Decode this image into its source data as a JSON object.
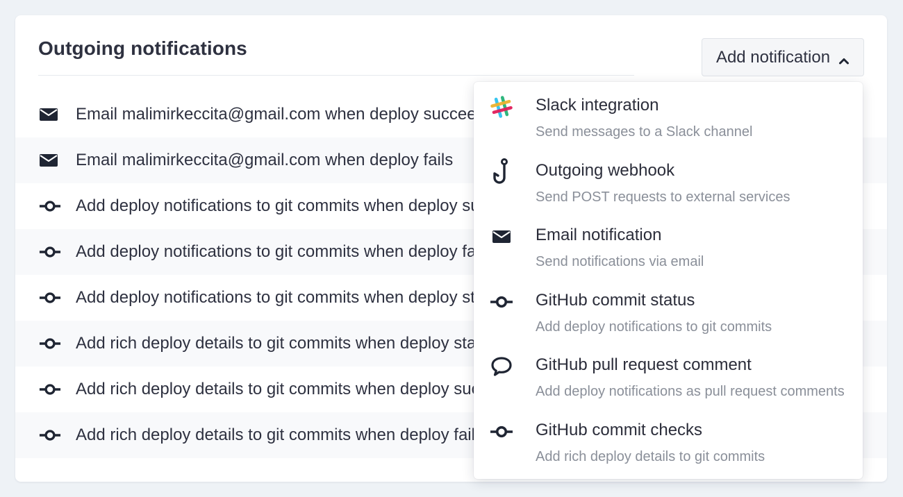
{
  "header": {
    "title": "Outgoing notifications",
    "add_button_label": "Add notification"
  },
  "notifications": [
    {
      "icon": "mail-icon",
      "text": "Email malimirkeccita@gmail.com when deploy succeeds"
    },
    {
      "icon": "mail-icon",
      "text": "Email malimirkeccita@gmail.com when deploy fails"
    },
    {
      "icon": "git-commit-icon",
      "text": "Add deploy notifications to git commits when deploy succ"
    },
    {
      "icon": "git-commit-icon",
      "text": "Add deploy notifications to git commits when deploy fails"
    },
    {
      "icon": "git-commit-icon",
      "text": "Add deploy notifications to git commits when deploy start"
    },
    {
      "icon": "git-commit-icon",
      "text": "Add rich deploy details to git commits when deploy starts"
    },
    {
      "icon": "git-commit-icon",
      "text": "Add rich deploy details to git commits when deploy succe"
    },
    {
      "icon": "git-commit-icon",
      "text": "Add rich deploy details to git commits when deploy fails"
    }
  ],
  "menu": {
    "items": [
      {
        "icon": "slack-icon",
        "label": "Slack integration",
        "description": "Send messages to a Slack channel"
      },
      {
        "icon": "hook-icon",
        "label": "Outgoing webhook",
        "description": "Send POST requests to external services"
      },
      {
        "icon": "mail-icon",
        "label": "Email notification",
        "description": "Send notifications via email"
      },
      {
        "icon": "git-commit-icon",
        "label": "GitHub commit status",
        "description": "Add deploy notifications to git commits"
      },
      {
        "icon": "comment-icon",
        "label": "GitHub pull request comment",
        "description": "Add deploy notifications as pull request comments"
      },
      {
        "icon": "git-commit-icon",
        "label": "GitHub commit checks",
        "description": "Add rich deploy details to git commits"
      }
    ]
  },
  "colors": {
    "icon": "#1f2533",
    "text": "#2e3140",
    "muted": "#8a8f99",
    "background": "#eef2f6",
    "slack_blue": "#36c5f0",
    "slack_green": "#2eb67d",
    "slack_yellow": "#ecb22e",
    "slack_red": "#e01e5a"
  }
}
